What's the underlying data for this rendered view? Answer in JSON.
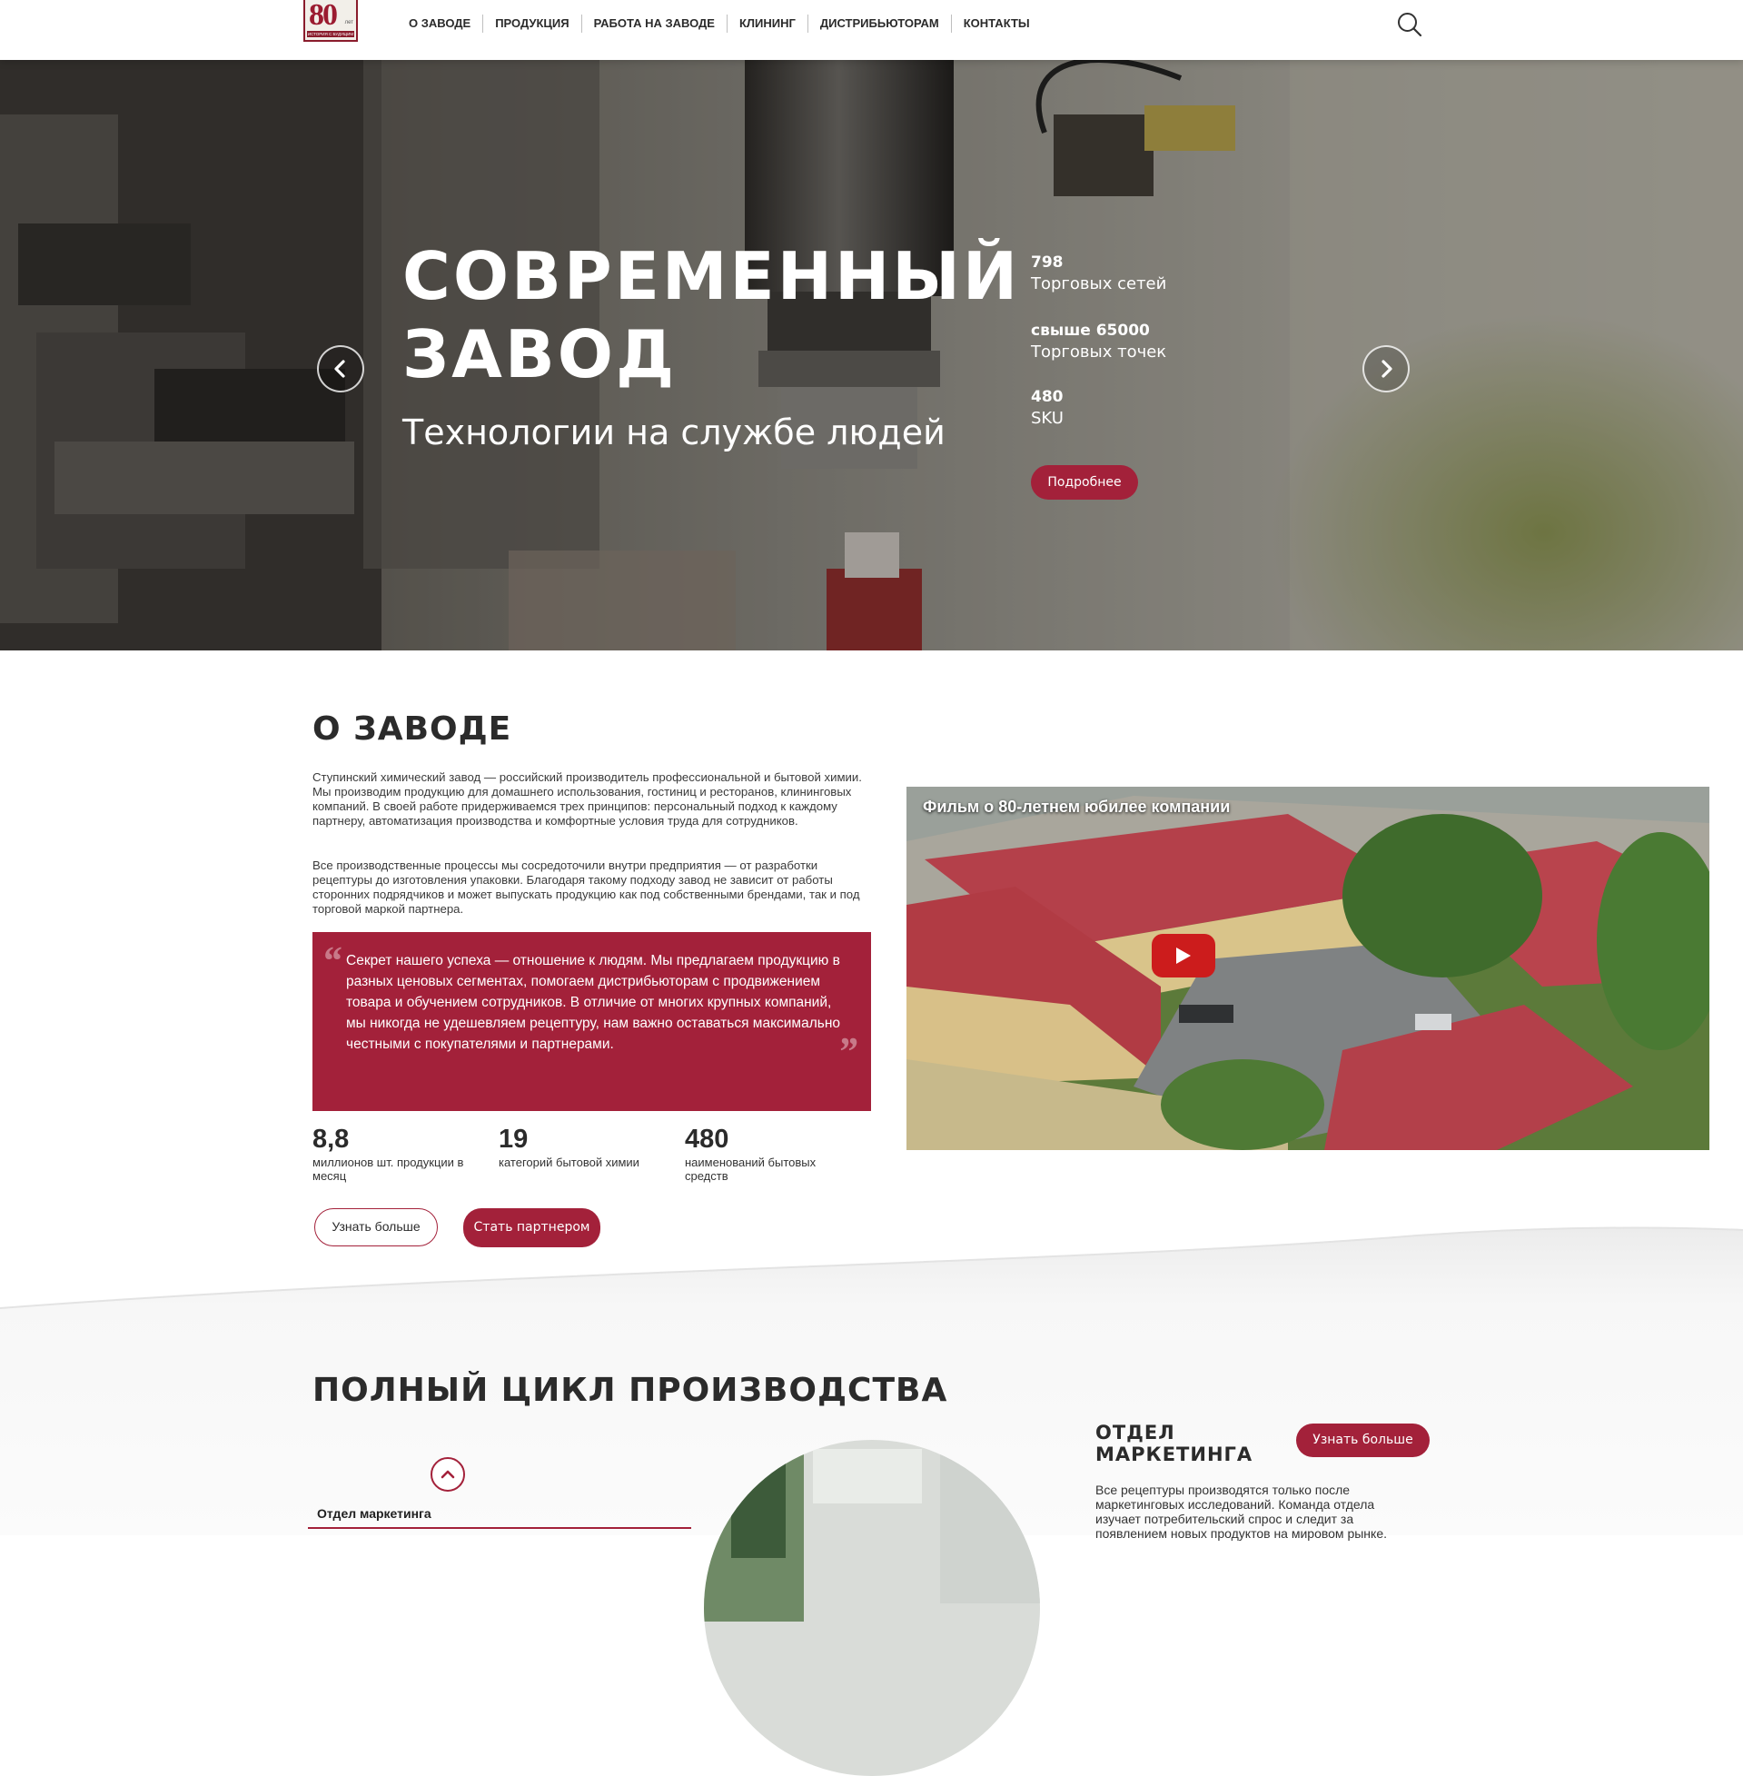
{
  "header": {
    "logo": {
      "number": "80",
      "years": "лет",
      "strip": "ИСТОРИЯ С БУДУЩИМ"
    },
    "nav": [
      {
        "label": "О ЗАВОДЕ"
      },
      {
        "label": "ПРОДУКЦИЯ"
      },
      {
        "label": "РАБОТА НА ЗАВОДЕ"
      },
      {
        "label": "КЛИНИНГ"
      },
      {
        "label": "ДИСТРИБЬЮТОРАМ"
      },
      {
        "label": "КОНТАКТЫ"
      }
    ],
    "search_icon": "search-icon"
  },
  "hero": {
    "title": "СОВРЕМЕННЫЙ ЗАВОД",
    "subtitle": "Технологии на службе людей",
    "stats": [
      {
        "value": "798",
        "label": "Торговых сетей"
      },
      {
        "value": "свыше 65000",
        "label": "Торговых точек"
      },
      {
        "value": "480",
        "label": "SKU"
      }
    ],
    "button_label": "Подробнее",
    "prev_icon": "chevron-left-icon",
    "next_icon": "chevron-right-icon"
  },
  "about": {
    "title": "О ЗАВОДЕ",
    "paragraphs": [
      "Ступинский химический завод — российский производитель профессиональной и бытовой химии. Мы производим продукцию для домашнего использования, гостиниц и ресторанов, клининговых компаний. В своей работе придерживаемся трех принципов: персональный подход к каждому партнеру, автоматизация производства и комфортные условия труда для сотрудников.",
      "Все производственные процессы мы сосредоточили внутри предприятия — от разработки рецептуры до изготовления упаковки. Благодаря такому подходу завод не зависит от работы сторонних подрядчиков и может выпускать продукцию как под собственными брендами, так и под торговой маркой партнера."
    ],
    "quote": "Секрет нашего успеха — отношение к людям. Мы предлагаем продукцию в разных ценовых сегментах, помогаем дистрибьюторам с продвижением товара и обучением сотрудников. В отличие от многих крупных компаний, мы никогда не удешевляем рецептуру, нам важно оставаться максимально честными с покупателями и партнерами.",
    "stats": [
      {
        "value": "8,8",
        "label": "миллионов шт. продукции в месяц"
      },
      {
        "value": "19",
        "label": "категорий бытовой химии"
      },
      {
        "value": "480",
        "label": "наименований бытовых средств"
      }
    ],
    "learn_more_label": "Узнать больше",
    "partner_label": "Стать партнером",
    "video": {
      "title": "Фильм о 80-летнем юбилее компании",
      "play_icon": "play-icon"
    }
  },
  "cycle": {
    "title": "ПОЛНЫЙ ЦИКЛ ПРОИЗВОДСТВА",
    "up_icon": "chevron-up-icon",
    "active_item": "Отдел маркетинга",
    "dept_title": "ОТДЕЛ МАРКЕТИНГА",
    "dept_button_label": "Узнать больше",
    "dept_text": "Все рецептуры производятся только после маркетинговых исследований. Команда отдела изучает потребительский спрос и следит за появлением новых продуктов на мировом рынке."
  },
  "colors": {
    "brand_red": "#a3213a",
    "youtube_red": "#cc1c1c",
    "text_dark": "#2b2b2b"
  }
}
